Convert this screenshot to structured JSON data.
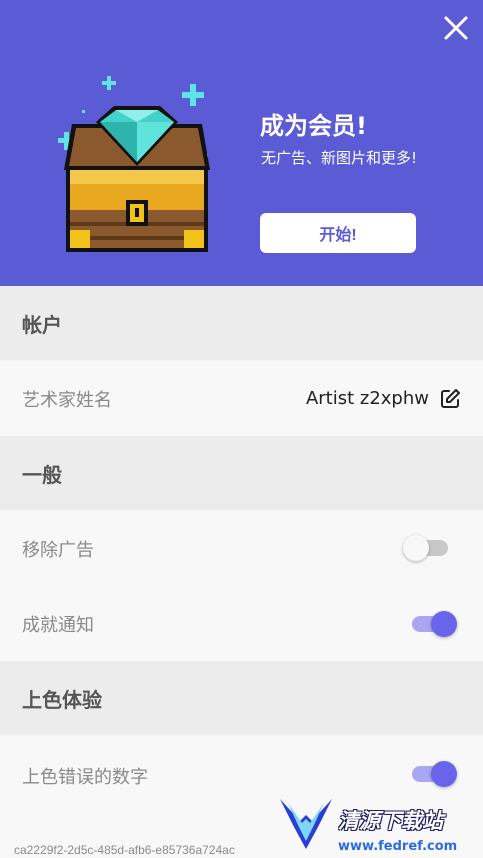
{
  "promo": {
    "title": "成为会员!",
    "subtitle": "无广告、新图片和更多!",
    "start_label": "开始!"
  },
  "sections": {
    "account": "帐户",
    "general": "一般",
    "coloring": "上色体验"
  },
  "account": {
    "artist_label": "艺术家姓名",
    "artist_name": "Artist z2xphw"
  },
  "general": {
    "remove_ads_label": "移除广告",
    "remove_ads_on": false,
    "achievement_label": "成就通知",
    "achievement_on": true
  },
  "coloring": {
    "wrong_numbers_label": "上色错误的数字",
    "wrong_numbers_on": true
  },
  "footer": {
    "id": "ca2229f2-2d5c-485d-afb6-e85736a724ac"
  },
  "watermark": {
    "text": "清源下载站",
    "url": "www.fedref.com"
  },
  "colors": {
    "banner": "#5b5bd6",
    "accent": "#6a64ec"
  }
}
